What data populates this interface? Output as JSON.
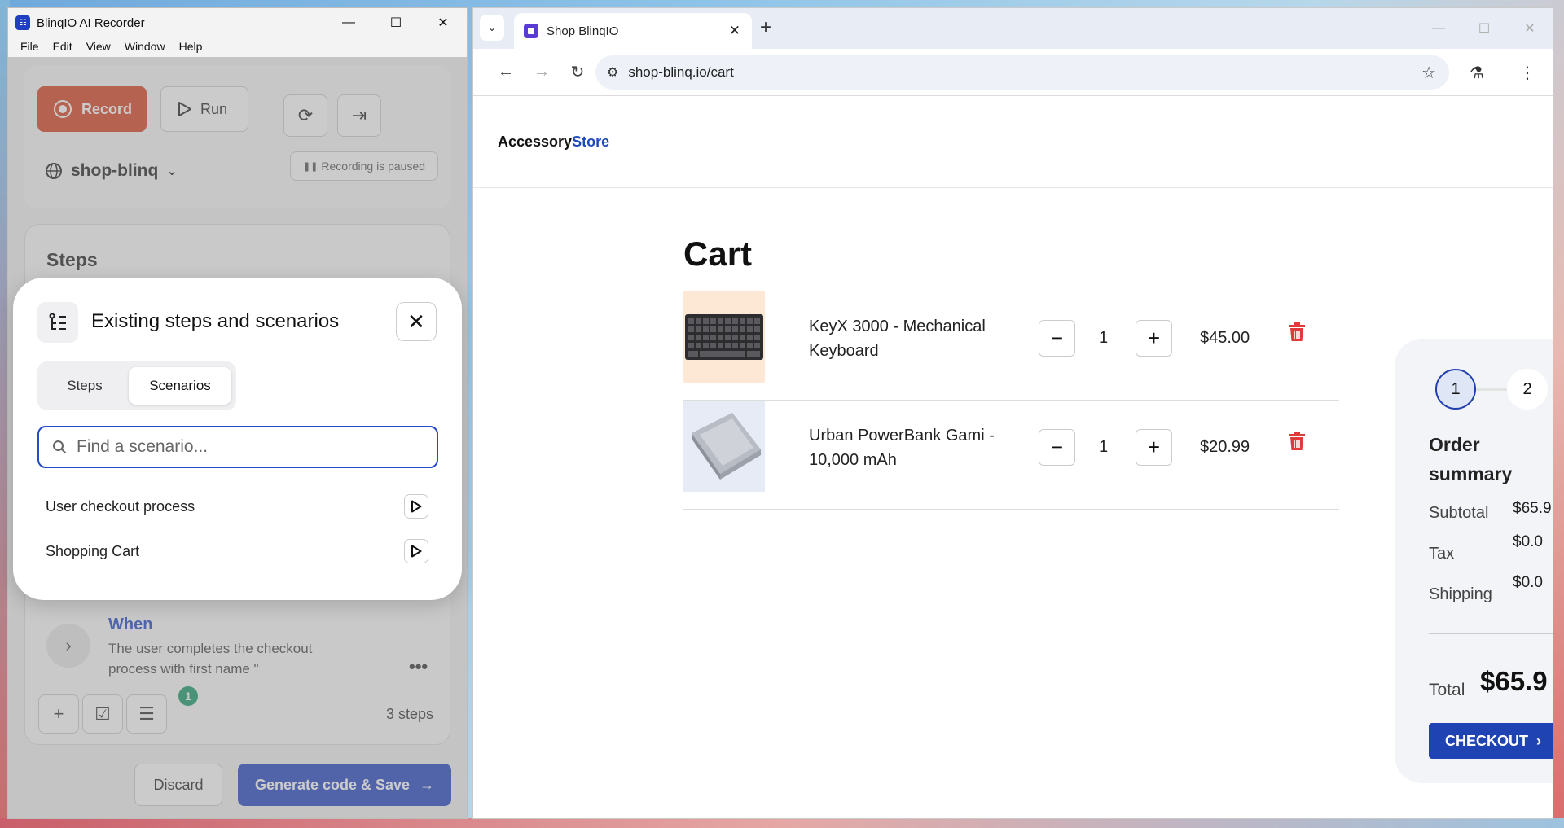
{
  "recorder": {
    "window_title": "BlinqIO AI Recorder",
    "menu": [
      "File",
      "Edit",
      "View",
      "Window",
      "Help"
    ],
    "record_label": "Record",
    "run_label": "Run",
    "project": "shop-blinq",
    "status": "Recording is paused",
    "steps_title": "Steps",
    "when_keyword": "When",
    "when_text": "The user completes the checkout process with first name \"",
    "badge_count": "1",
    "steps_count": "3 steps",
    "discard_label": "Discard",
    "generate_label": "Generate code & Save"
  },
  "modal": {
    "title": "Existing steps and scenarios",
    "tabs": [
      {
        "label": "Steps",
        "active": false
      },
      {
        "label": "Scenarios",
        "active": true
      }
    ],
    "search_placeholder": "Find a scenario...",
    "scenarios": [
      "User checkout process",
      "Shopping Cart"
    ]
  },
  "browser": {
    "tab_title": "Shop BlinqIO",
    "url": "shop-blinq.io/cart"
  },
  "store": {
    "logo_part1": "Accessory",
    "logo_part2": "Store",
    "cart_title": "Cart",
    "items": [
      {
        "name": "KeyX 3000 - Mechanical Keyboard",
        "qty": "1",
        "price": "$45.00"
      },
      {
        "name": "Urban PowerBank Gami - 10,000 mAh",
        "qty": "1",
        "price": "$20.99"
      }
    ],
    "summary": {
      "steps": [
        "1",
        "2"
      ],
      "title": "Order summary",
      "subtotal_label": "Subtotal",
      "subtotal": "$65.9",
      "tax_label": "Tax",
      "tax": "$0.0",
      "shipping_label": "Shipping",
      "shipping": "$0.0",
      "total_label": "Total",
      "total": "$65.9",
      "checkout_label": "CHECKOUT"
    }
  },
  "colors": {
    "record_red": "#d8401f",
    "primary_blue": "#2244c4",
    "store_blue": "#1f4bb8",
    "trash_red": "#e03a3a",
    "badge_green": "#159a6b"
  }
}
